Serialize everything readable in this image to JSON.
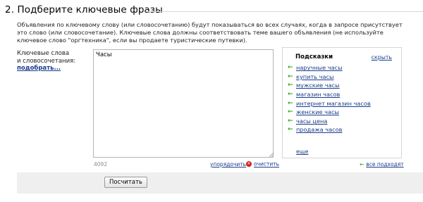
{
  "section": {
    "title": "2. Подберите ключевые фразы"
  },
  "description": "Объявления по ключевому слову (или словосочетанию) будут показываться во всех случаях, когда в запросе присутствует это слово (или словосочетание). Ключевые слова должны соответствовать теме вашего объявления (не используйте ключевое слово \"оргтехника\", если вы продаете туристические путевки).",
  "keywords": {
    "label_line1": "Ключевые слова",
    "label_line2": "и словосочетания:",
    "pick_link": "подобрать...",
    "value": "Часы",
    "char_count": "4092",
    "sort_link": "упорядочить",
    "clear_link": "очистить",
    "clear_icon": "close-circle-icon"
  },
  "hints": {
    "title": "Подсказки",
    "hide_link": "скрыть",
    "items": [
      "наручные часы",
      "купить часы",
      "мужские часы",
      "магазин часов",
      "интернет магазин часов",
      "женские часы",
      "часы цена",
      "продажа часов"
    ],
    "more_link": "еще",
    "unfit_link": "все подходят",
    "arrow_icon": "arrow-left-icon",
    "arrow_color": "#3cab26"
  },
  "actions": {
    "calculate_button": "Посчитать"
  },
  "colors": {
    "link": "#1a3d8c",
    "footer_bg": "#efefef",
    "clear_icon_bg": "#d42020"
  }
}
